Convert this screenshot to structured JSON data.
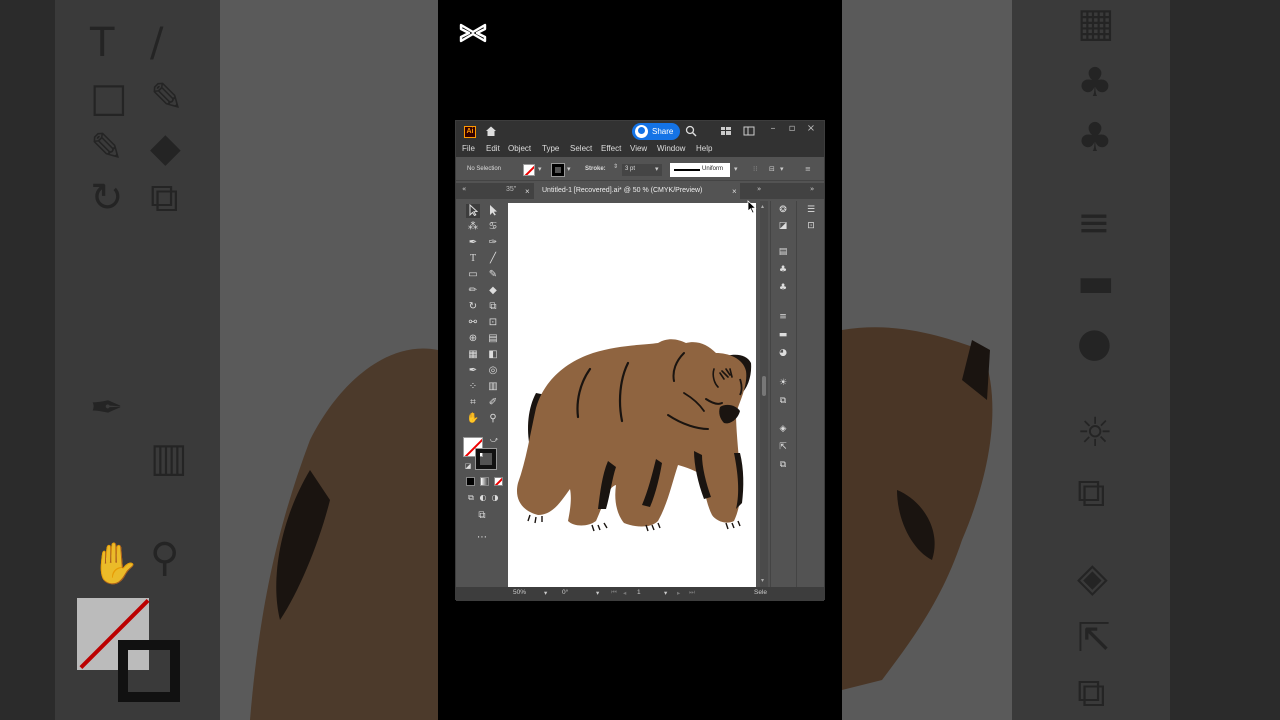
{
  "window": {
    "app_badge": "Ai",
    "share_label": "Share"
  },
  "menu": [
    "File",
    "Edit",
    "Object",
    "Type",
    "Select",
    "Effect",
    "View",
    "Window",
    "Help"
  ],
  "control": {
    "selection_label": "No Selection",
    "stroke_label": "Stroke:",
    "stroke_weight": "3 pt",
    "profile_label": "Uniform"
  },
  "document": {
    "prev_tab": "35\"",
    "active_tab": "Untitled-1 [Recovered].ai* @ 50 % (CMYK/Preview)",
    "close_glyph": "×"
  },
  "status": {
    "zoom": "50%",
    "rotation": "0°",
    "artboard_num": "1",
    "tool_hint": "Sele"
  },
  "colors": {
    "bear_fur": "#8f6440",
    "bear_dark": "#1a1410",
    "accent_blue": "#1473e6"
  }
}
